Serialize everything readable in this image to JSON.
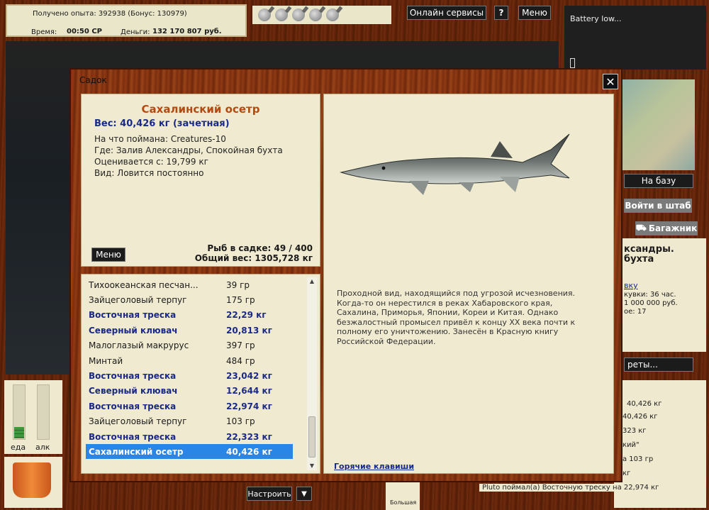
{
  "status": {
    "experience": "Получено опыта: 392938 (Бонус: 130979)",
    "time_label": "Время:",
    "time_value": "00:50 СР",
    "money_label": "Деньги:",
    "money_value": "132 170 807 руб."
  },
  "topbar": {
    "online_services": "Онлайн сервисы",
    "help": "?",
    "menu": "Меню"
  },
  "battery": {
    "text": "Battery low..."
  },
  "right_side": {
    "to_base": "На базу",
    "enter_hq": "Войти в штаб",
    "trunk": "Багажник",
    "location_1": "ксандры.",
    "location_2": "бухта",
    "link_partial": "вку",
    "line_1": "кувки: 36 час.",
    "line_2": "1 000 000 руб.",
    "line_3": "ое: 17",
    "secrets_btn": "реты...",
    "log_1": "40,426 кг",
    "log_2": "40,426 кг",
    "log_3": "323 кг",
    "log_4": "кий\"",
    "log_5": "а 103 гр",
    "log_6": "кг",
    "log_7": "Pluto поймал(а) Восточную треску на 22,974 кг"
  },
  "indicators": {
    "food": "еда",
    "alc": "алк"
  },
  "bottom": {
    "settings": "Настроить",
    "dropdown": "▼",
    "big": "Большая"
  },
  "dialog": {
    "title": "Садок",
    "close": "✕",
    "fish_name": "Сахалинский осетр",
    "weight": "Вес: 40,426 кг (зачетная)",
    "caught_on": "На что поймана: Creatures-10",
    "where": "Где: Залив Александры, Спокойная бухта",
    "valued_from": "Оценивается с: 19,799 кг",
    "kind": "Вид: Ловится постоянно",
    "menu": "Меню",
    "keep_count": "Рыб в садке: 49 / 400",
    "total_weight": "Общий вес: 1305,728 кг",
    "description": "Проходной вид, находящийся под угрозой исчезновения.  Когда-то он нерестился в  реках Хабаровского края, Сахалина, Приморья, Японии, Кореи и Китая. Однако безжалостный промысел привёл к концу XX века почти к полному его уничтожению. Занесён в Красную книгу Российской Федерации.",
    "hotkeys": "Горячие клавиши"
  },
  "catch_list": [
    {
      "name": "Тихоокеанская песчан...",
      "weight": "39 гр",
      "trophy": false,
      "selected": false
    },
    {
      "name": "Зайцеголовый терпуг",
      "weight": "175 гр",
      "trophy": false,
      "selected": false
    },
    {
      "name": "Восточная треска",
      "weight": "22,29 кг",
      "trophy": true,
      "selected": false
    },
    {
      "name": "Северный клювач",
      "weight": "20,813 кг",
      "trophy": true,
      "selected": false
    },
    {
      "name": "Малоглазый макрурус",
      "weight": "397 гр",
      "trophy": false,
      "selected": false
    },
    {
      "name": "Минтай",
      "weight": "484 гр",
      "trophy": false,
      "selected": false
    },
    {
      "name": "Восточная треска",
      "weight": "23,042 кг",
      "trophy": true,
      "selected": false
    },
    {
      "name": "Северный клювач",
      "weight": "12,644 кг",
      "trophy": true,
      "selected": false
    },
    {
      "name": "Восточная треска",
      "weight": "22,974 кг",
      "trophy": true,
      "selected": false
    },
    {
      "name": "Зайцеголовый терпуг",
      "weight": "103 гр",
      "trophy": false,
      "selected": false
    },
    {
      "name": "Восточная треска",
      "weight": "22,323 кг",
      "trophy": true,
      "selected": false
    },
    {
      "name": "Сахалинский осетр",
      "weight": "40,426 кг",
      "trophy": true,
      "selected": true
    }
  ],
  "colors": {
    "fish_title": "#b24a12",
    "trophy_text": "#1b2a86",
    "selection": "#2a86e6"
  }
}
